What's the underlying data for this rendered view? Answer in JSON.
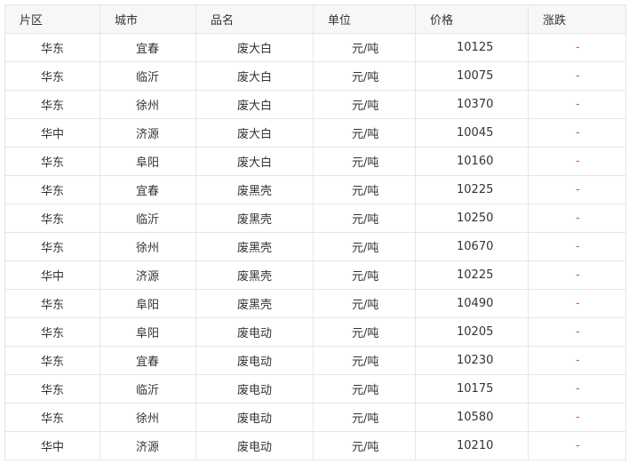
{
  "table": {
    "headers": [
      "片区",
      "城市",
      "品名",
      "单位",
      "价格",
      "涨跌"
    ],
    "rows": [
      {
        "area": "华东",
        "city": "宜春",
        "product": "废大白",
        "unit": "元/吨",
        "price": "10125",
        "change": "-"
      },
      {
        "area": "华东",
        "city": "临沂",
        "product": "废大白",
        "unit": "元/吨",
        "price": "10075",
        "change": "-"
      },
      {
        "area": "华东",
        "city": "徐州",
        "product": "废大白",
        "unit": "元/吨",
        "price": "10370",
        "change": "-"
      },
      {
        "area": "华中",
        "city": "济源",
        "product": "废大白",
        "unit": "元/吨",
        "price": "10045",
        "change": "-"
      },
      {
        "area": "华东",
        "city": "阜阳",
        "product": "废大白",
        "unit": "元/吨",
        "price": "10160",
        "change": "-"
      },
      {
        "area": "华东",
        "city": "宜春",
        "product": "废黑壳",
        "unit": "元/吨",
        "price": "10225",
        "change": "-"
      },
      {
        "area": "华东",
        "city": "临沂",
        "product": "废黑壳",
        "unit": "元/吨",
        "price": "10250",
        "change": "-"
      },
      {
        "area": "华东",
        "city": "徐州",
        "product": "废黑壳",
        "unit": "元/吨",
        "price": "10670",
        "change": "-"
      },
      {
        "area": "华中",
        "city": "济源",
        "product": "废黑壳",
        "unit": "元/吨",
        "price": "10225",
        "change": "-"
      },
      {
        "area": "华东",
        "city": "阜阳",
        "product": "废黑壳",
        "unit": "元/吨",
        "price": "10490",
        "change": "-"
      },
      {
        "area": "华东",
        "city": "阜阳",
        "product": "废电动",
        "unit": "元/吨",
        "price": "10205",
        "change": "-"
      },
      {
        "area": "华东",
        "city": "宜春",
        "product": "废电动",
        "unit": "元/吨",
        "price": "10230",
        "change": "-"
      },
      {
        "area": "华东",
        "city": "临沂",
        "product": "废电动",
        "unit": "元/吨",
        "price": "10175",
        "change": "-"
      },
      {
        "area": "华东",
        "city": "徐州",
        "product": "废电动",
        "unit": "元/吨",
        "price": "10580",
        "change": "-"
      },
      {
        "area": "华中",
        "city": "济源",
        "product": "废电动",
        "unit": "元/吨",
        "price": "10210",
        "change": "-"
      }
    ]
  },
  "colors": {
    "header_bg": "#f7f7f7",
    "border": "#e6e6e6",
    "text": "#333333",
    "change": "#d9534f"
  }
}
